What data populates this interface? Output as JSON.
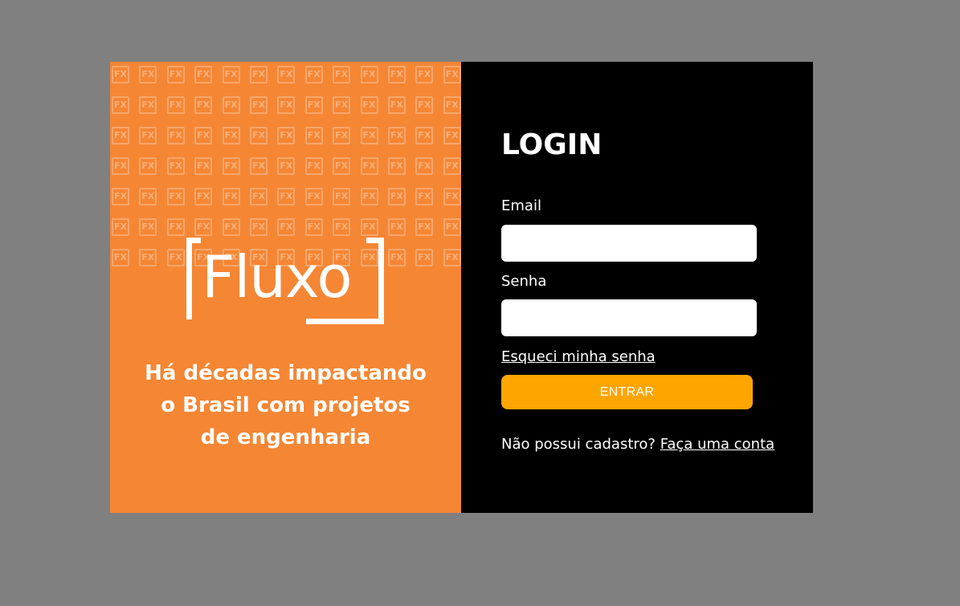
{
  "brand": {
    "logo_text": "Fluxo",
    "pattern_glyph": "FX",
    "tagline_lines": [
      "Há décadas impactando",
      "o Brasil com projetos",
      "de engenharia"
    ],
    "panel_color": "#f58634"
  },
  "login": {
    "title": "LOGIN",
    "email_label": "Email",
    "email_value": "",
    "password_label": "Senha",
    "password_value": "",
    "forgot_password": "Esqueci minha senha",
    "submit_label": "ENTRAR",
    "submit_color": "#ffa500",
    "signup_prompt": "Não possui cadastro?",
    "signup_link": "Faça uma conta"
  },
  "colors": {
    "background": "#808080",
    "login_panel": "#000000"
  }
}
